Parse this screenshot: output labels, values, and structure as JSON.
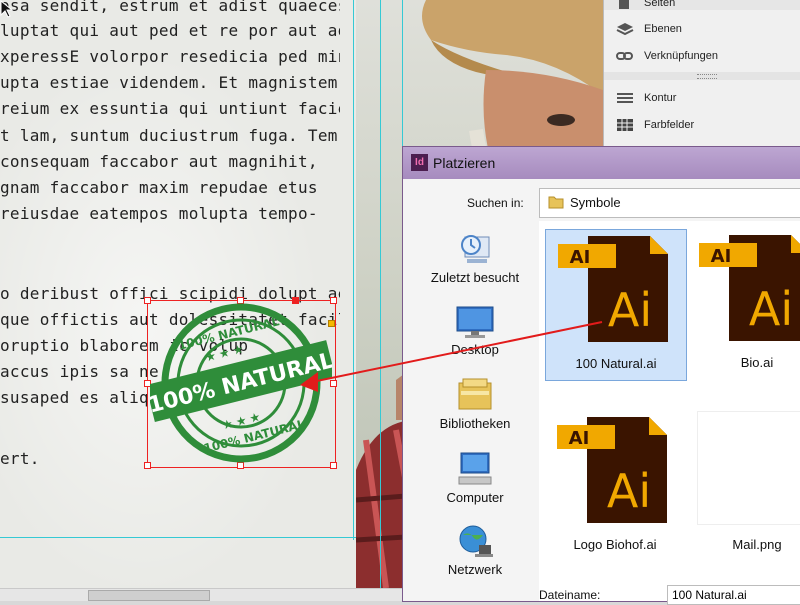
{
  "document": {
    "text_lines_1": [
      "osa sendit, estrum et adist quaecest",
      "luptat qui aut ped et re por aut ad",
      "xperessE volorpor resedicia ped min-",
      "upta estiae videndem. Et magnistem",
      " reium ex essuntia qui untiunt facietur",
      "t lam, suntum duciustrum fuga. Tem-",
      " consequam faccabor aut magnihit,",
      "gnam faccabor maxim repudae etus",
      " reiusdae eatempos molupta tempo-"
    ],
    "text_lines_2": [
      "o deribust offici scipidi dolupt ae pe",
      " que offictis aut dolessitatet facilitia",
      "oruptio blaborem ic volup",
      " accus ipis sa ne",
      "susaped es aliqui"
    ],
    "text_line_end": "ert.",
    "stamp": {
      "top_text": "100% NATURAL",
      "band_text": "100% NATURAL",
      "bottom_text": "100% NATURAL",
      "color": "#2f8d3a"
    },
    "arrow_color": "#e21b1b"
  },
  "panels": {
    "items": [
      {
        "label": "Seiten",
        "icon": "pages-icon"
      },
      {
        "label": "Ebenen",
        "icon": "layers-icon"
      },
      {
        "label": "Verknüpfungen",
        "icon": "links-icon"
      },
      {
        "label": "Kontur",
        "icon": "stroke-icon"
      },
      {
        "label": "Farbfelder",
        "icon": "swatches-icon"
      }
    ]
  },
  "dialog": {
    "app_icon": "Id",
    "title": "Platzieren",
    "search_label": "Suchen in:",
    "folder": "Symbole",
    "sidebar": [
      {
        "label": "Zuletzt besucht",
        "icon": "recent-places-icon"
      },
      {
        "label": "Desktop",
        "icon": "desktop-icon"
      },
      {
        "label": "Bibliotheken",
        "icon": "libraries-icon"
      },
      {
        "label": "Computer",
        "icon": "computer-icon"
      },
      {
        "label": "Netzwerk",
        "icon": "network-icon"
      }
    ],
    "files": [
      {
        "name": "100 Natural.ai",
        "type": "AI",
        "selected": true
      },
      {
        "name": "Bio.ai",
        "type": "AI",
        "selected": false
      },
      {
        "name": "Logo Biohof.ai",
        "type": "AI",
        "selected": false
      },
      {
        "name": "Mail.png",
        "type": "PNG",
        "selected": false
      }
    ],
    "file_icon_text": {
      "badge": "AI",
      "big": "Ai"
    },
    "filename_label": "Dateiname:",
    "filename_value": "100 Natural.ai"
  }
}
